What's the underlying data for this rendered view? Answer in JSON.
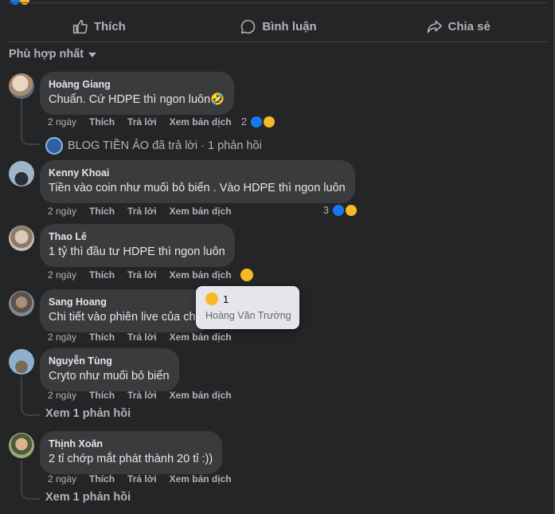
{
  "actions": {
    "like": "Thích",
    "comment": "Bình luận",
    "share": "Chia sẻ"
  },
  "sort_label": "Phù hợp nhất",
  "comment_actions": {
    "like": "Thích",
    "reply": "Trả lời",
    "translate": "Xem bản dịch"
  },
  "comments": [
    {
      "author": "Hoàng Giang",
      "text": "Chuẩn. Cứ HDPE thì ngon luôn🤣",
      "time": "2 ngày",
      "reaction_count": "2"
    },
    {
      "author": "Kenny Khoai",
      "text": "Tiền vào coin như muối bỏ biển . Vào HDPE thì ngon luôn",
      "time": "2 ngày",
      "reaction_count": "3"
    },
    {
      "author": "Thao Lê",
      "text": "1 tỷ thì đầu tư HDPE thì ngon luôn",
      "time": "2 ngày",
      "reaction_count": ""
    },
    {
      "author": "Sang Hoang",
      "text": "Chi tiết vào phiên live của chú",
      "time": "2 ngày",
      "reaction_count": ""
    },
    {
      "author": "Nguyễn Tùng",
      "text": "Cryto như muối bỏ biển",
      "time": "2 ngày",
      "reaction_count": ""
    },
    {
      "author": "Thịnh Xoăn",
      "text": "2 tỉ chớp mắt phát thành 20 tỉ :))",
      "time": "2 ngày",
      "reaction_count": ""
    }
  ],
  "reply_threads": {
    "blog": "BLOG TIỀN ẢO đã trả lời · 1 phản hồi",
    "view1": "Xem 1 phản hồi",
    "view2": "Xem 1 phản hồi"
  },
  "tooltip": {
    "count": "1",
    "name": "Hoàng Văn Trường"
  },
  "colors": {
    "background": "#242526",
    "bubble": "#3a3b3c",
    "text": "#e4e6eb",
    "secondary": "#b0b3b8",
    "like_blue": "#1877f2",
    "haha_yellow": "#f7b928"
  }
}
